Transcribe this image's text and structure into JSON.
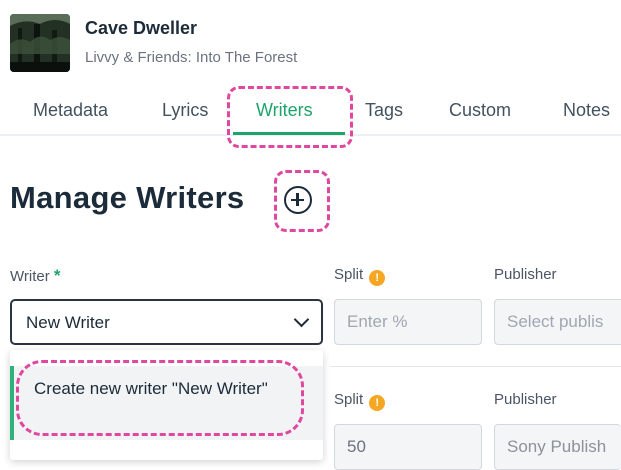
{
  "header": {
    "song_title": "Cave Dweller",
    "album": "Livvy & Friends: Into The Forest"
  },
  "tabs": [
    {
      "label": "Metadata",
      "active": false
    },
    {
      "label": "Lyrics",
      "active": false
    },
    {
      "label": "Writers",
      "active": true
    },
    {
      "label": "Tags",
      "active": false
    },
    {
      "label": "Custom",
      "active": false
    },
    {
      "label": "Notes",
      "active": false
    }
  ],
  "page": {
    "title": "Manage Writers",
    "add_icon": "plus-circle-icon"
  },
  "form": {
    "writer_label": "Writer",
    "required_mark": "*",
    "split_label": "Split",
    "publisher_label": "Publisher",
    "info_icon": "info-icon",
    "writer_value": "New Writer",
    "split_placeholder": "Enter %",
    "publisher_placeholder": "Select publis",
    "dropdown_option": "Create new writer \"New Writer\""
  },
  "row2": {
    "split_label": "Split",
    "publisher_label": "Publisher",
    "split_value": "50",
    "publisher_value": "Sony Publish"
  },
  "colors": {
    "accent": "#1ea46a",
    "info": "#f5a623",
    "highlight": "#e0479e"
  }
}
